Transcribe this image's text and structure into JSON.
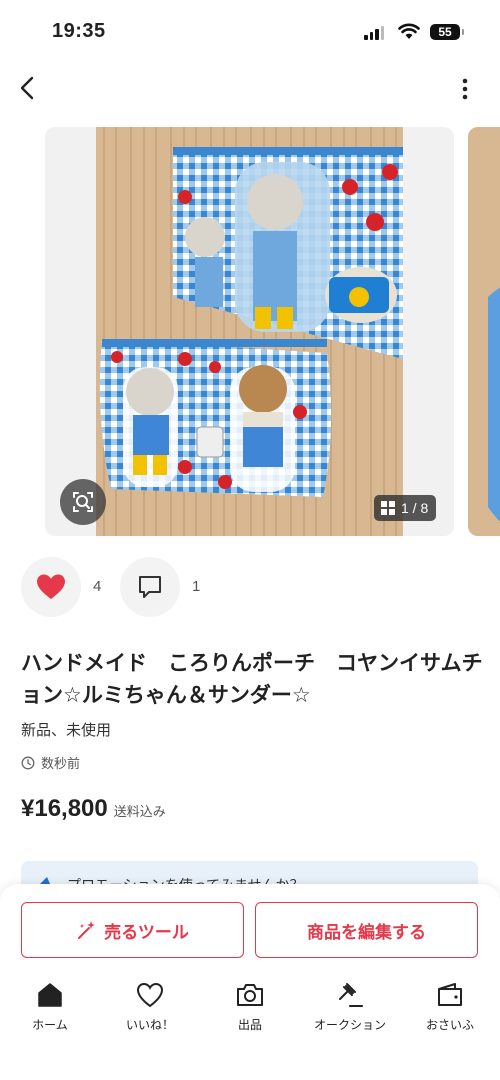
{
  "status_bar": {
    "time": "19:35",
    "battery": "55"
  },
  "carousel": {
    "counter": "1 / 8"
  },
  "actions": {
    "likes": "4",
    "comments": "1"
  },
  "item": {
    "title": "ハンドメイド　ころりんポーチ　コヤンイサムチョン☆ルミちゃん＆サンダー☆",
    "condition": "新品、未使用",
    "posted": "数秒前",
    "price": "¥16,800",
    "shipping": "送料込み"
  },
  "promo": {
    "text": "プロモーションを使ってみませんか？"
  },
  "buttons": {
    "sell_tool": "売るツール",
    "edit_item": "商品を編集する"
  },
  "tabs": [
    {
      "label": "ホーム",
      "icon": "home-icon"
    },
    {
      "label": "いいね！",
      "icon": "heart-icon"
    },
    {
      "label": "出品",
      "icon": "camera-icon"
    },
    {
      "label": "オークション",
      "icon": "gavel-icon"
    },
    {
      "label": "おさいふ",
      "icon": "wallet-icon"
    }
  ],
  "colors": {
    "accent": "#e5384a",
    "promo_bg": "#e8f0f9",
    "promo_icon": "#1f6fd1"
  }
}
